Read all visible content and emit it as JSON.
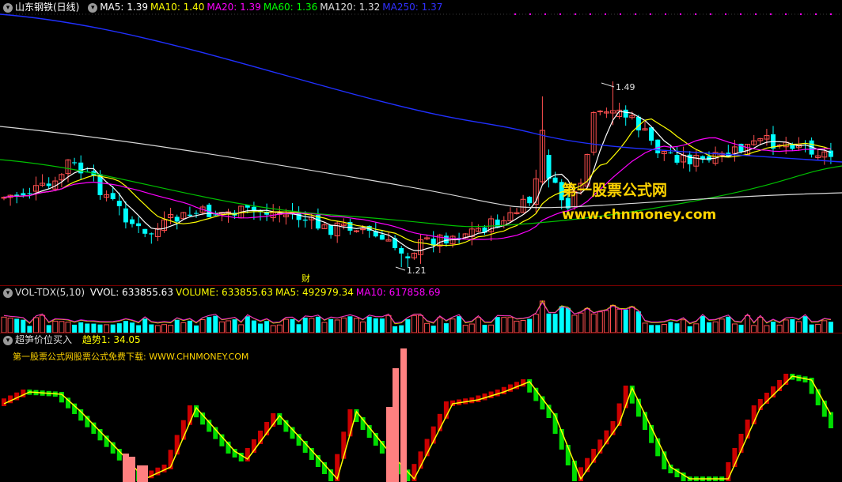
{
  "main": {
    "stock_name": "山东钢铁(日线)",
    "ma_items": [
      {
        "text": "MA5: 1.39",
        "color": "#ffffff"
      },
      {
        "text": "MA10: 1.40",
        "color": "#ffff00"
      },
      {
        "text": "MA20: 1.39",
        "color": "#ff00ff"
      },
      {
        "text": "MA60: 1.36",
        "color": "#00ff00"
      },
      {
        "text": "MA120: 1.32",
        "color": "#e0e0e0"
      },
      {
        "text": "MA250: 1.37",
        "color": "#3030ff"
      }
    ],
    "high_label": "1.49",
    "low_label": "1.21",
    "marker_label": "财",
    "watermark_cn": "第一股票公式网",
    "watermark_url": "www.chnmoney.com"
  },
  "volume": {
    "indicator": "VOL-TDX(5,10)",
    "items": [
      {
        "text": "VVOL: 633855.63",
        "color": "#ffffff"
      },
      {
        "text": "VOLUME: 633855.63",
        "color": "#ffff00"
      },
      {
        "text": "MA5: 492979.34",
        "color": "#ffff00"
      },
      {
        "text": "MA10: 617858.69",
        "color": "#ff00ff"
      }
    ]
  },
  "indicator": {
    "name": "超笋价位买入",
    "trend_label": "趋势1: 34.05",
    "note": "第一股票公式网股票公式免费下载: WWW.CHNMONEY.COM"
  },
  "colors": {
    "up": "#ff4f4f",
    "down": "#00ffff",
    "osc_up": "#cc0000",
    "osc_down": "#00dd00",
    "osc_line": "#ffff00",
    "spike": "#ff8080",
    "divider": "#7a0000"
  }
}
